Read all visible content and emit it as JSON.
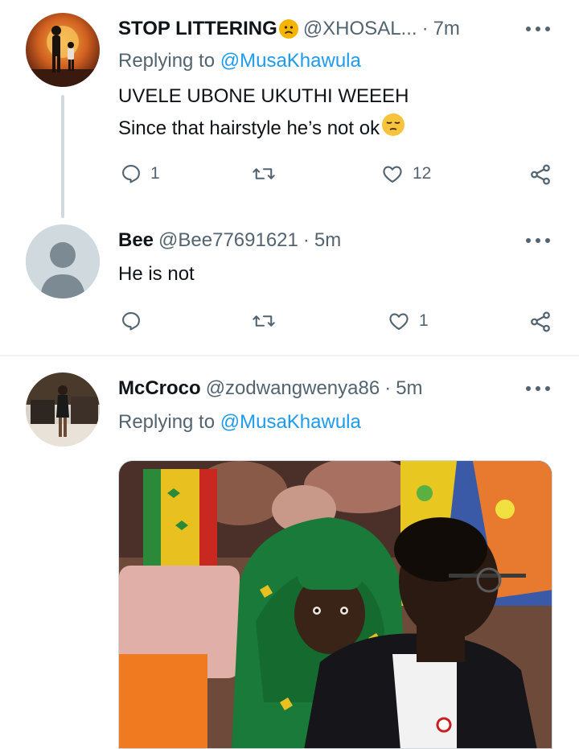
{
  "tweets": [
    {
      "name": "STOP LITTERING",
      "handle": "@XHOSAL...",
      "time": "7m",
      "replying_prefix": "Replying to",
      "replying_to": "@MusaKhawula",
      "lines": [
        "UVELE UBONE UKUTHI WEEEH",
        "Since that hairstyle he’s not ok"
      ],
      "replies": "1",
      "retweets": "",
      "likes": "12"
    },
    {
      "name": "Bee",
      "handle": "@Bee77691621",
      "time": "5m",
      "lines": [
        "He is not"
      ],
      "replies": "",
      "retweets": "",
      "likes": "1"
    },
    {
      "name": "McCroco",
      "handle": "@zodwangwenya86",
      "time": "5m",
      "replying_prefix": "Replying to",
      "replying_to": "@MusaKhawula"
    }
  ],
  "separator": "·",
  "colors": {
    "text": "#0f1419",
    "secondary": "#536471",
    "link": "#1d9bf0",
    "thread_line": "#cfd9de",
    "divider": "#eff3f4"
  },
  "icons": [
    "reply-icon",
    "retweet-icon",
    "like-icon",
    "share-icon",
    "more-icon",
    "frowning-face-emoji",
    "pensive-face-emoji"
  ]
}
